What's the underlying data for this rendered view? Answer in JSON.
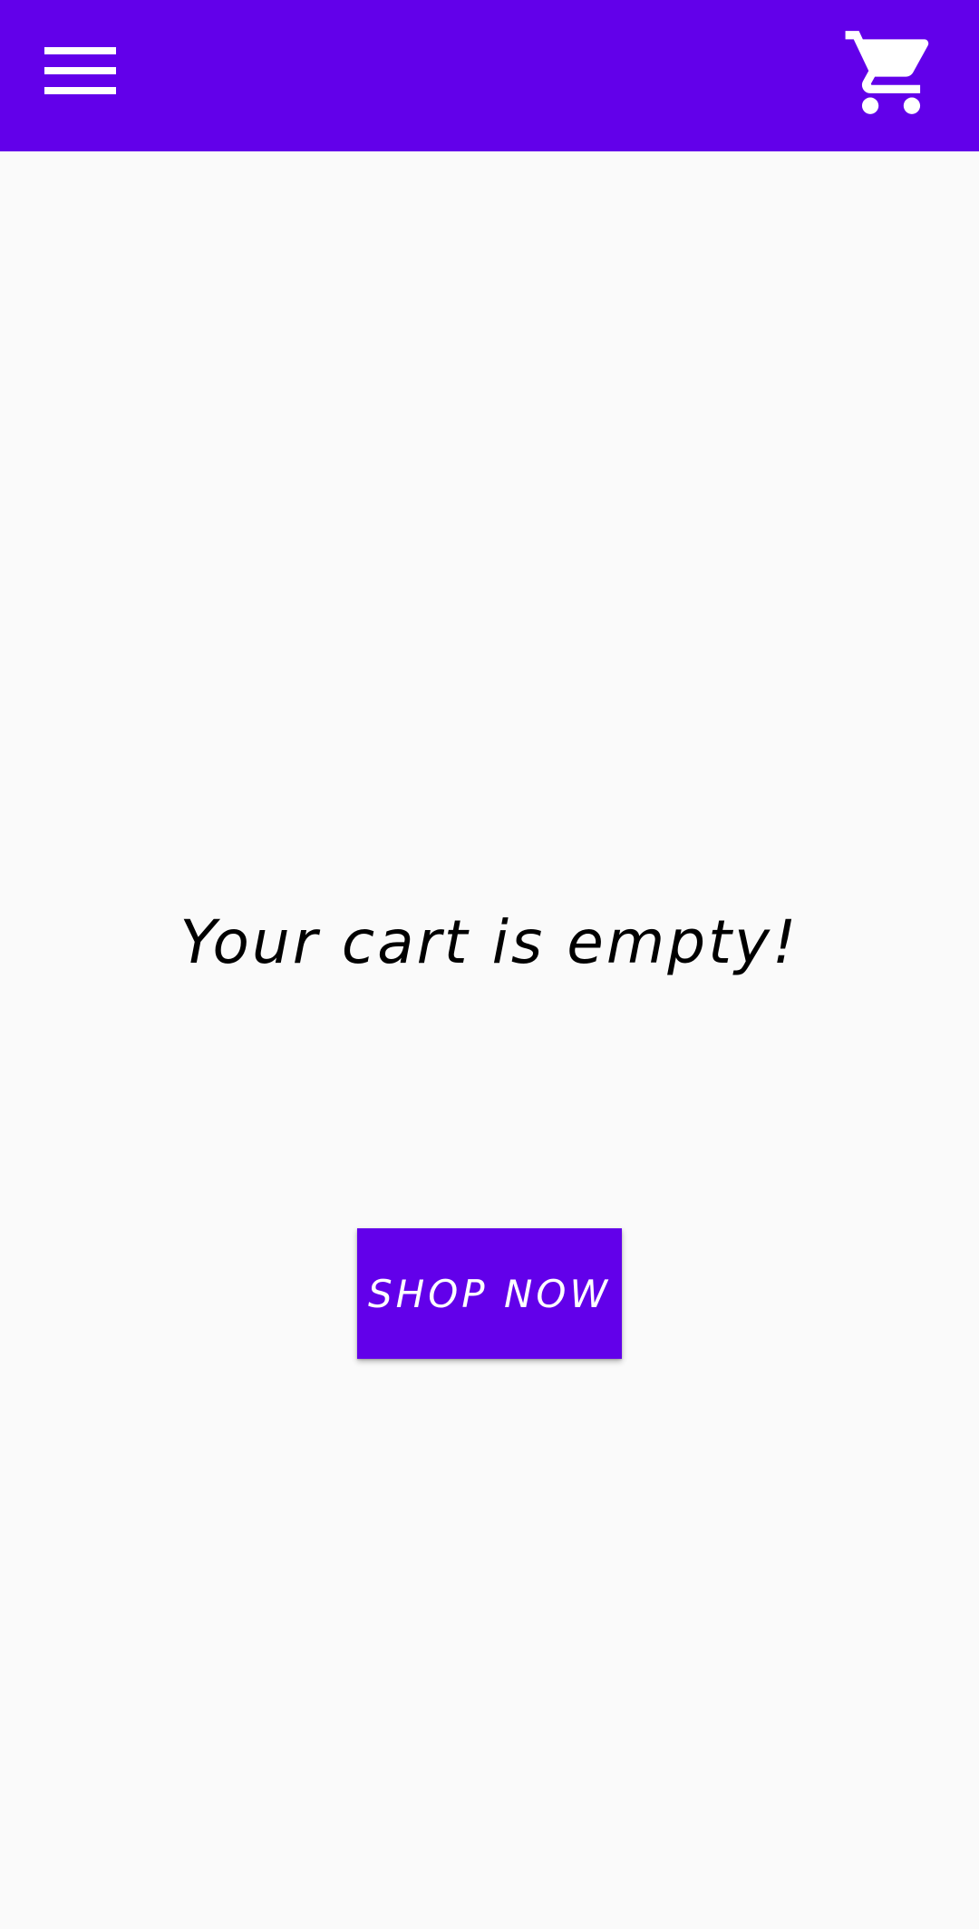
{
  "app_bar": {
    "background": "#6200ea",
    "menu_icon": "hamburger-menu-icon",
    "cart_icon": "shopping-cart-icon"
  },
  "main": {
    "empty_message": "Your cart is empty!",
    "shop_button_label": "SHOP NOW"
  },
  "colors": {
    "primary": "#6200ea",
    "background": "#fafafa",
    "text": "#000000",
    "on_primary": "#ffffff"
  }
}
